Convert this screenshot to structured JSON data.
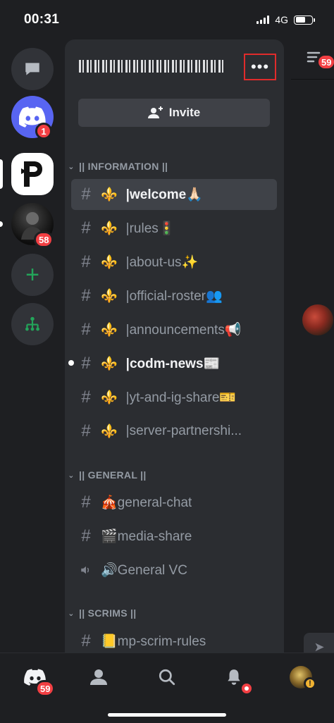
{
  "status_bar": {
    "time": "00:31",
    "network": "4G"
  },
  "servers": {
    "discord_badge": "1",
    "photo_server_badge": "58"
  },
  "panel": {
    "server_name": "",
    "more_label": "•••",
    "invite_label": "Invite",
    "categories": [
      {
        "name": "|| INFORMATION ||",
        "channels": [
          {
            "type": "text",
            "emoji": "⚜️",
            "name": "|welcome🙏🏻",
            "state": "selected"
          },
          {
            "type": "text",
            "emoji": "⚜️",
            "name": "|rules🚦",
            "state": "normal"
          },
          {
            "type": "text",
            "emoji": "⚜️",
            "name": "|about-us✨",
            "state": "normal"
          },
          {
            "type": "text",
            "emoji": "⚜️",
            "name": "|official-roster👥",
            "state": "normal"
          },
          {
            "type": "text",
            "emoji": "⚜️",
            "name": "|announcements📢",
            "state": "normal"
          },
          {
            "type": "text",
            "emoji": "⚜️",
            "name": "|codm-news📰",
            "state": "unread"
          },
          {
            "type": "text",
            "emoji": "⚜️",
            "name": "|yt-and-ig-share🎫",
            "state": "normal"
          },
          {
            "type": "text",
            "emoji": "⚜️",
            "name": "|server-partnershi...",
            "state": "normal"
          }
        ]
      },
      {
        "name": "|| GENERAL ||",
        "channels": [
          {
            "type": "text",
            "emoji": "🎪",
            "name": "general-chat",
            "state": "normal"
          },
          {
            "type": "text",
            "emoji": "🎬",
            "name": "media-share",
            "state": "normal"
          },
          {
            "type": "voice",
            "emoji": "🔊",
            "name": "General VC",
            "state": "normal"
          }
        ]
      },
      {
        "name": "|| SCRIMS ||",
        "channels": [
          {
            "type": "text",
            "emoji": "📒",
            "name": "mp-scrim-rules",
            "state": "normal"
          }
        ]
      }
    ]
  },
  "peek": {
    "badge": "59"
  },
  "tabbar": {
    "home_badge": "59"
  },
  "colors": {
    "background": "#1e1f22",
    "panel": "#2b2d31",
    "blurple": "#5865f2",
    "badge_red": "#f23f43",
    "green": "#23a55a",
    "highlight_box": "#e02b2b"
  }
}
